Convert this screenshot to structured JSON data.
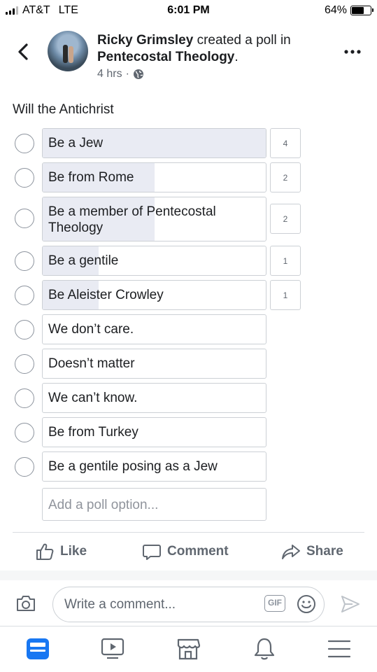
{
  "status_bar": {
    "carrier": "AT&T",
    "network": "LTE",
    "time": "6:01 PM",
    "battery": "64%",
    "battery_level": 0.64
  },
  "post": {
    "author": "Ricky Grimsley",
    "action_text": " created a poll in ",
    "group": "Pentecostal Theology",
    "period": ".",
    "time_ago": "4 hrs",
    "separator": "·",
    "privacy_icon": "globe-icon"
  },
  "poll": {
    "question": "Will the Antichrist",
    "options": [
      {
        "label": "Be a Jew",
        "votes": "4",
        "share": 1.0
      },
      {
        "label": "Be from Rome",
        "votes": "2",
        "share": 0.5
      },
      {
        "label": "Be a member of Pentecostal Theology",
        "votes": "2",
        "share": 0.5
      },
      {
        "label": "Be a gentile",
        "votes": "1",
        "share": 0.25
      },
      {
        "label": "Be Aleister Crowley",
        "votes": "1",
        "share": 0.25
      },
      {
        "label": "We don’t care.",
        "votes": "",
        "share": 0
      },
      {
        "label": "Doesn’t matter",
        "votes": "",
        "share": 0
      },
      {
        "label": "We can’t know.",
        "votes": "",
        "share": 0
      },
      {
        "label": "Be from Turkey",
        "votes": "",
        "share": 0
      },
      {
        "label": "Be a gentile posing as a Jew",
        "votes": "",
        "share": 0
      }
    ],
    "add_option_placeholder": "Add a poll option..."
  },
  "actions": {
    "like": "Like",
    "comment": "Comment",
    "share": "Share"
  },
  "composer": {
    "placeholder": "Write a comment...",
    "gif_label": "GIF"
  },
  "tab_bar": {
    "items": [
      "news-feed-icon",
      "watch-icon",
      "marketplace-icon",
      "notifications-icon",
      "menu-icon"
    ],
    "active": 0,
    "active_color": "#1877f2"
  },
  "colors": {
    "bar_fill": "#e9ebf3",
    "muted_text": "#606770",
    "border": "#ccd0d5"
  }
}
